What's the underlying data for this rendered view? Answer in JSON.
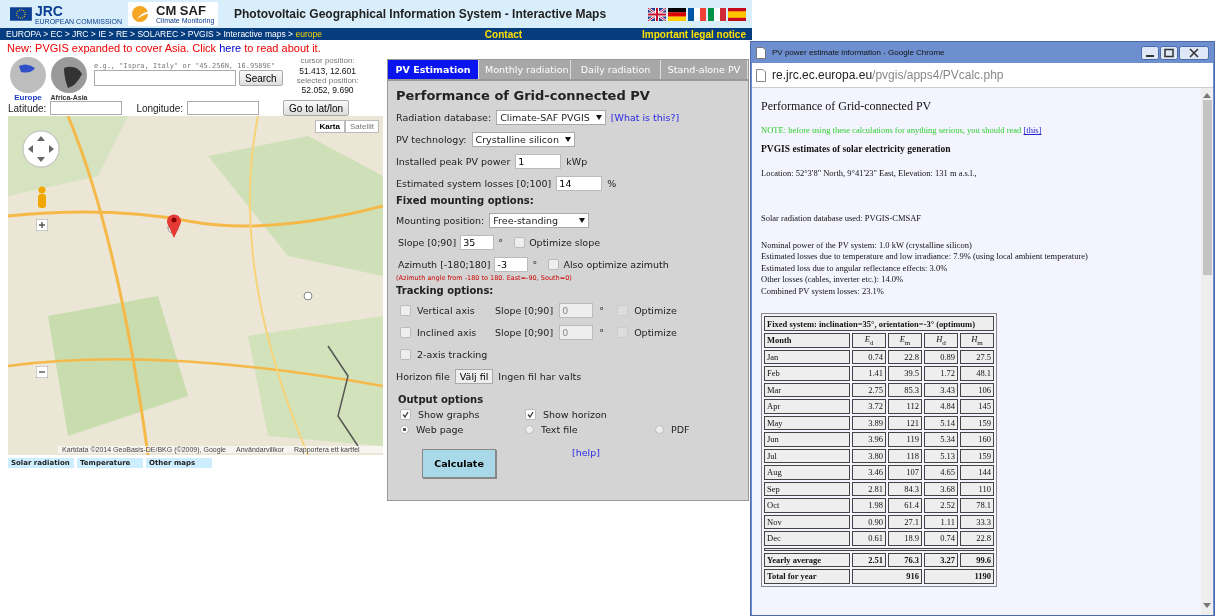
{
  "header": {
    "logos": [
      {
        "kind": "eu",
        "text": "JRC",
        "sub": "EUROPEAN COMMISSION"
      },
      {
        "kind": "sun",
        "text": "CM SAF",
        "sub": "Climate Monitoring"
      }
    ],
    "title": "Photovoltaic Geographical Information System - Interactive Maps",
    "flags": [
      {
        "kind": "uk"
      },
      {
        "kind": "de"
      },
      {
        "kind": "fr"
      },
      {
        "kind": "it"
      },
      {
        "kind": "es"
      }
    ]
  },
  "breadcrumb": {
    "path": "EUROPA > EC > JRC > IE > RE > SOLAREC > PVGIS > Interactive maps >",
    "current": "europe",
    "links": [
      "Contact",
      "Important legal notice"
    ]
  },
  "notice": {
    "before": "New: PVGIS expanded to cover Asia. Click ",
    "link": "here",
    "after": " to read about it."
  },
  "regions": [
    {
      "label": "Europe",
      "selected": true
    },
    {
      "label": "Africa-Asia",
      "selected": false
    }
  ],
  "search": {
    "hint": "e.g., \"Ispra, Italy\" or \"45.256N, 16.9589E\"",
    "button": "Search"
  },
  "positions": [
    {
      "label": "cursor position:",
      "value": "51.413, 12.601"
    },
    {
      "label": "selected position:",
      "value": "52.052, 9.690"
    }
  ],
  "coords": {
    "lat_label": "Latitude:",
    "lon_label": "Longitude:",
    "button": "Go to lat/lon"
  },
  "map": {
    "kind": "picture",
    "map_types": [
      {
        "label": "Karta",
        "selected": true
      },
      {
        "label": "Satellit",
        "selected": false
      }
    ],
    "attribution": [
      "Kartdata ©2014 GeoBasis-DE/BKG (©2009), Google",
      "Användarvillkor",
      "Rapportera ett kartfel"
    ]
  },
  "map_tabs": [
    "Solar radiation",
    "Temperature",
    "Other maps"
  ],
  "form": {
    "tabs": [
      {
        "label": "PV Estimation",
        "selected": true
      },
      {
        "label": "Monthly radiation",
        "selected": false
      },
      {
        "label": "Daily radiation",
        "selected": false
      },
      {
        "label": "Stand-alone PV",
        "selected": false
      }
    ],
    "title": "Performance of Grid-connected PV",
    "radiation_db": {
      "label": "Radiation database:",
      "value": "Climate-SAF PVGIS",
      "link": "[What is this?]"
    },
    "technology": {
      "label": "PV technology:",
      "value": "Crystalline silicon"
    },
    "peak_power": {
      "label": "Installed peak PV power",
      "value": "1",
      "unit": "kWp"
    },
    "losses": {
      "label": "Estimated system losses [0;100]",
      "value": "14",
      "unit": "%"
    },
    "fixed_heading": "Fixed mounting options:",
    "mounting": {
      "label": "Mounting position:",
      "value": "Free-standing"
    },
    "angles": [
      {
        "label": "Slope [0;90]",
        "value": "35",
        "unit": "°",
        "option": "Optimize slope",
        "checked": false
      },
      {
        "label": "Azimuth [-180;180]",
        "value": "-3",
        "unit": "°",
        "option": "Also optimize azimuth",
        "checked": false
      }
    ],
    "azimuth_note": "(Azimuth angle from -180 to 180. East=-90, South=0)",
    "tracking_heading": "Tracking options:",
    "tracking": [
      {
        "kind": "axis",
        "label": "Vertical axis",
        "checked": false,
        "slope_label": "Slope [0;90]",
        "value": "0",
        "unit": "°",
        "disabled": true,
        "optimize": "Optimize",
        "optimize_checked": false
      },
      {
        "kind": "axis",
        "label": "Inclined axis",
        "checked": false,
        "slope_label": "Slope [0;90]",
        "value": "0",
        "unit": "°",
        "disabled": true,
        "optimize": "Optimize",
        "optimize_checked": false
      },
      {
        "kind": "plain",
        "label": "2-axis tracking",
        "checked": false
      }
    ],
    "horizon": {
      "label": "Horizon file",
      "button": "Välj fil",
      "status": "Ingen fil har valts"
    },
    "output_heading": "Output options",
    "output_checks": [
      {
        "label": "Show graphs",
        "checked": true
      },
      {
        "label": "Show horizon",
        "checked": true
      }
    ],
    "output_formats": [
      {
        "label": "Web page",
        "selected": true
      },
      {
        "label": "Text file",
        "selected": false
      },
      {
        "label": "PDF",
        "selected": false
      }
    ],
    "calculate": "Calculate",
    "help": "[help]"
  },
  "popup": {
    "title": "PV power estimate information - Google Chrome",
    "url_host": "re.jrc.ec.europa.eu",
    "url_path": "/pvgis/apps4/PVcalc.php",
    "heading": "Performance of Grid-connected PV",
    "note": "NOTE: before using these calculations for anything serious, you should read ",
    "note_link": "[this]",
    "subheading": "PVGIS estimates of solar electricity generation",
    "location": "Location: 52°3'8\" North, 9°41'23\" East, Elevation: 131 m a.s.l.,",
    "database": "Solar radiation database used: PVGIS-CMSAF",
    "details": [
      "Nominal power of the PV system: 1.0 kW (crystalline silicon)",
      "Estimated losses due to temperature and low irradiance: 7.9% (using local ambient temperature)",
      "Estimated loss due to angular reflectance effects: 3.0%",
      "Other losses (cables, inverter etc.): 14.0%",
      "Combined PV system losses: 23.1%"
    ],
    "table": {
      "caption": "Fixed system: inclination=35°, orientation=-3° (optimum)",
      "columns": [
        "Month",
        "*E*$_{d}$",
        "*E*$_{m}$",
        "*H*$_{d}$",
        "*H*$_{m}$"
      ],
      "rows": [
        [
          "Jan",
          "0.74",
          "22.8",
          "0.89",
          "27.5"
        ],
        [
          "Feb",
          "1.41",
          "39.5",
          "1.72",
          "48.1"
        ],
        [
          "Mar",
          "2.75",
          "85.3",
          "3.43",
          "106"
        ],
        [
          "Apr",
          "3.72",
          "112",
          "4.84",
          "145"
        ],
        [
          "May",
          "3.89",
          "121",
          "5.14",
          "159"
        ],
        [
          "Jun",
          "3.96",
          "119",
          "5.34",
          "160"
        ],
        [
          "Jul",
          "3.80",
          "118",
          "5.13",
          "159"
        ],
        [
          "Aug",
          "3.46",
          "107",
          "4.65",
          "144"
        ],
        [
          "Sep",
          "2.81",
          "84.3",
          "3.68",
          "110"
        ],
        [
          "Oct",
          "1.98",
          "61.4",
          "2.52",
          "78.1"
        ],
        [
          "Nov",
          "0.90",
          "27.1",
          "1.11",
          "33.3"
        ],
        [
          "Dec",
          "0.61",
          "18.9",
          "0.74",
          "22.8"
        ]
      ],
      "yearly": [
        "Yearly average",
        "2.51",
        "76.3",
        "3.27",
        "99.6"
      ],
      "total": [
        "Total for year",
        "916",
        "1190"
      ]
    }
  }
}
